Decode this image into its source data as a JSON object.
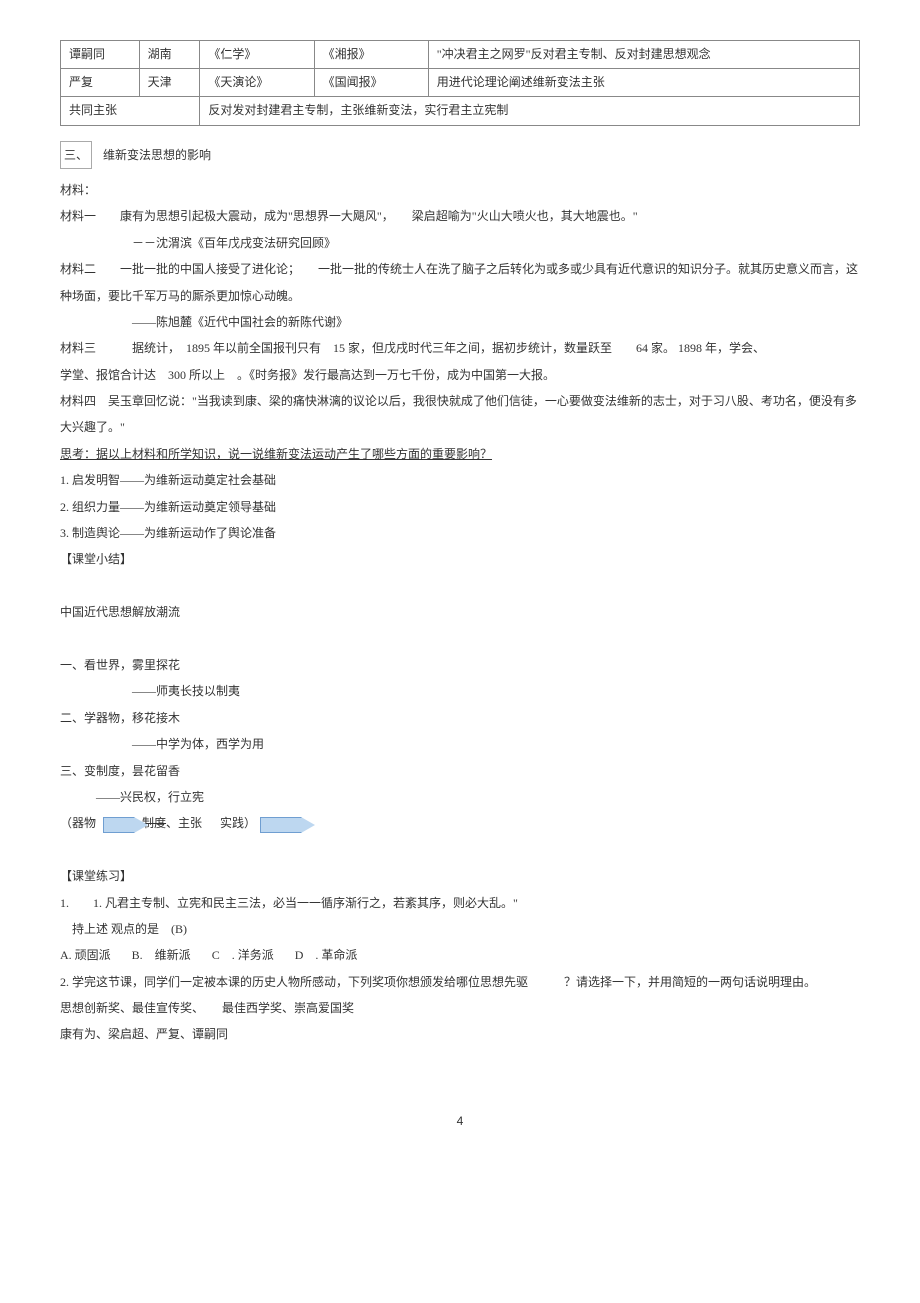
{
  "table": {
    "r1": {
      "c1": "谭嗣同",
      "c2": "湖南",
      "c3": "《仁学》",
      "c4": "《湘报》",
      "c5": "\"冲决君主之网罗\"反对君主专制、反对封建思想观念"
    },
    "r2": {
      "c1": "严复",
      "c2": "天津",
      "c3": "《天演论》",
      "c4": "《国闻报》",
      "c5": "用进代论理论阐述维新变法主张"
    },
    "r3": {
      "c1": "共同主张",
      "c2": "反对发对封建君主专制，主张维新变法，实行君主立宪制"
    }
  },
  "section3": {
    "label_box": "三、",
    "title": "维新变法思想的影响",
    "materials_label": "材料：",
    "m1": "材料一　　康有为思想引起极大震动，成为\"思想界一大飓风\"，　　梁启超喻为\"火山大喷火也，其大地震也。\"",
    "m1_src": "－－沈渭滨《百年戊戌变法研究回顾》",
    "m2": "材料二　　一批一批的中国人接受了进化论；　　一批一批的传统士人在洗了脑子之后转化为或多或少具有近代意识的知识分子。就其历史意义而言，这种场面，要比千军万马的厮杀更加惊心动魄。",
    "m2_src": "——陈旭麓《近代中国社会的新陈代谢》",
    "m3a": "材料三　　　据统计，　1895 年以前全国报刊只有　15 家，但戊戌时代三年之间，据初步统计，数量跃至　　64 家。 1898 年，学会、",
    "m3b": "学堂、报馆合计达　300 所以上　。《时务报》发行最高达到一万七千份，成为中国第一大报。",
    "m4": "材料四　吴玉章回忆说：\"当我读到康、梁的痛快淋漓的议论以后，我很快就成了他们信徒，一心要做变法维新的志士，对于习八股、考功名，便没有多大兴趣了。\"",
    "think": "思考：据以上材料和所学知识，说一说维新变法运动产生了哪些方面的重要影响？",
    "pt1": "1. 启发明智——为维新运动奠定社会基础",
    "pt2": "2. 组织力量——为维新运动奠定领导基础",
    "pt3": "3. 制造舆论——为维新运动作了舆论准备"
  },
  "summary": {
    "label": "【课堂小结】",
    "title": "中国近代思想解放潮流",
    "i1": "一、看世界，雾里探花",
    "i1s": "——师夷长技以制夷",
    "i2": "二、学器物，移花接木",
    "i2s": "——中学为体，西学为用",
    "i3": "三、变制度，昙花留香",
    "i3s": "——兴民权，行立宪",
    "flow_a": "（器物",
    "flow_b": "制度",
    "flow_c": "、主张",
    "flow_d": "实践）"
  },
  "exercise": {
    "label": "【课堂练习】",
    "q1": "1.　　1. 凡君主专制、立宪和民主三法，必当一一循序渐行之，若紊其序，则必大乱。\"",
    "q1b": "持上述 观点的是　(B)",
    "q1_optA": "A. 顽固派",
    "q1_optB": "B.　维新派",
    "q1_optC": "C　. 洋务派",
    "q1_optD": "D　. 革命派",
    "q2": "2. 学完这节课，同学们一定被本课的历史人物所感动，下列奖项你想颁发给哪位思想先驱　　　？请选择一下，并用简短的一两句话说明理由。",
    "q2_awards": "思想创新奖、最佳宣传奖、　　最佳西学奖、崇高爱国奖",
    "q2_names": "康有为、梁启超、严复、谭嗣同"
  },
  "page_number": "4"
}
